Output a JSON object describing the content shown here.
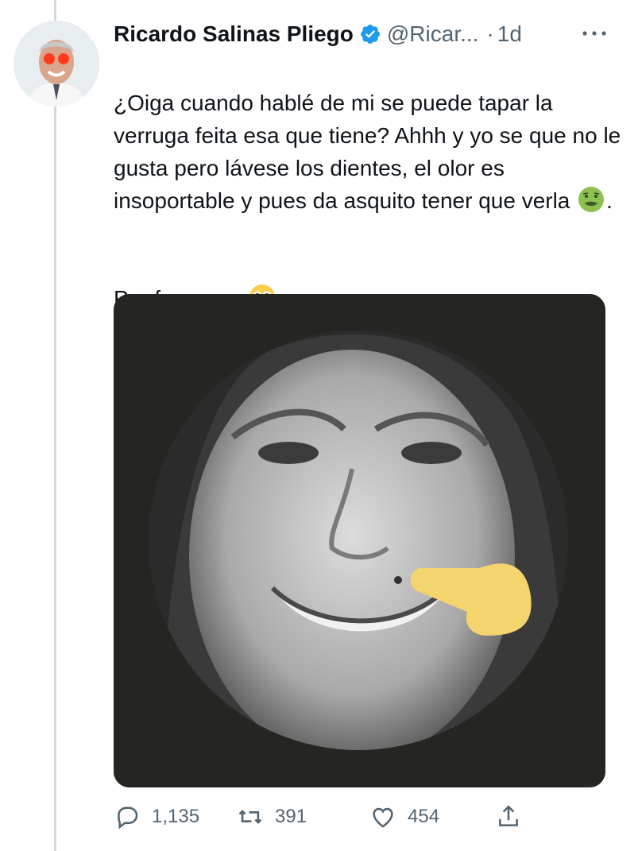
{
  "tweet": {
    "display_name": "Ricardo Salinas Pliego",
    "handle": "@Ricar...",
    "dot": "·",
    "time": "1d",
    "text_line1": "¿Oiga cuando hablé de mi se puede tapar la verruga feita esa que tiene? Ahhh y yo se que no le gusta pero lávese los dientes, el olor es insoportable y pues da asquito tener que verla",
    "text_line1_end": ".",
    "text_line2": "Por favoooor",
    "text_line2_end": ".",
    "emoji1": "nauseated-face",
    "emoji2": "pleading-face"
  },
  "actions": {
    "replies": "1,135",
    "retweets": "391",
    "likes": "454"
  },
  "colors": {
    "text": "#0f1419",
    "muted": "#536471",
    "verified": "#1d9bf0",
    "thread_line": "#cfd9de",
    "media_bg": "#252621",
    "pointer": "#f4d46c"
  }
}
